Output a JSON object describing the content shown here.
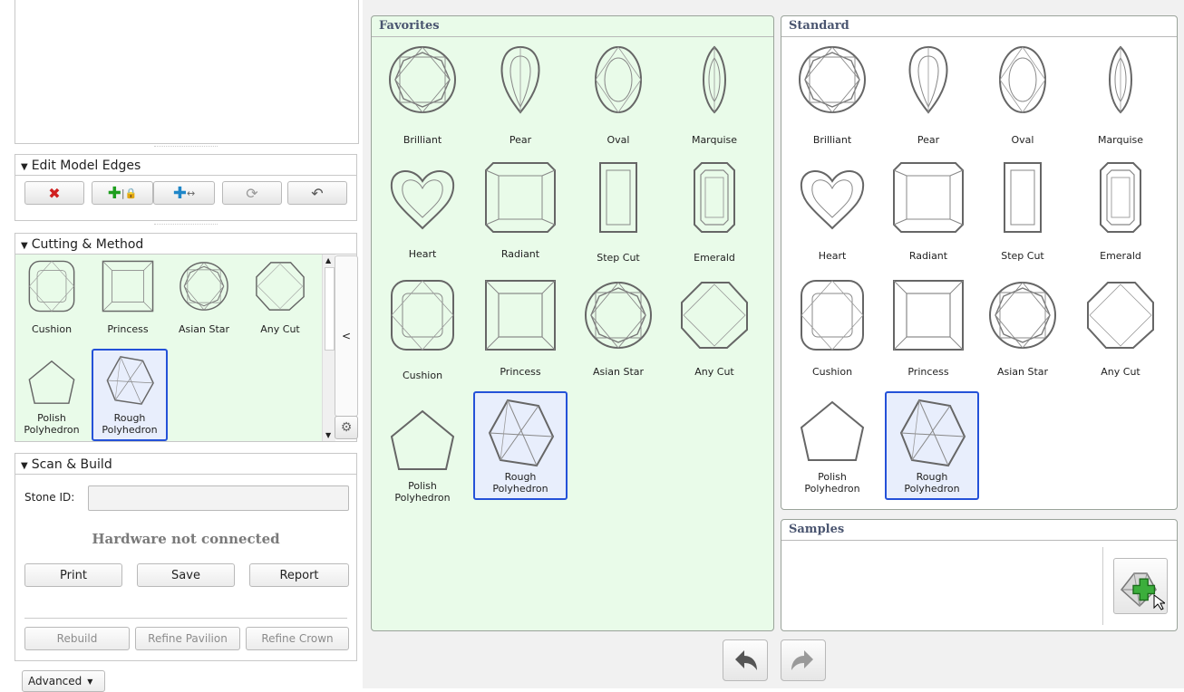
{
  "edit_edges": {
    "title": "Edit Model Edges",
    "buttons": [
      "delete-icon",
      "add-lock-icon",
      "add-move-icon",
      "refresh-icon",
      "undo-icon"
    ]
  },
  "cutting": {
    "title": "Cutting & Method",
    "items": [
      "Cushion",
      "Princess",
      "Asian Star",
      "Any Cut"
    ],
    "polish_line1": "Polish",
    "polish_line2": "Polyhedron",
    "rough_line1": "Rough",
    "rough_line2": "Polyhedron",
    "collapse_label": "<"
  },
  "scan": {
    "title": "Scan & Build",
    "stone_id_label": "Stone ID:",
    "stone_id_value": "",
    "status": "Hardware not connected",
    "print": "Print",
    "save": "Save",
    "report": "Report",
    "rebuild": "Rebuild",
    "refine_pavilion": "Refine Pavilion",
    "refine_crown": "Refine Crown"
  },
  "advanced_label": "Advanced",
  "favorites": {
    "title": "Favorites",
    "items": [
      "Brilliant",
      "Pear",
      "Oval",
      "Marquise",
      "Heart",
      "Radiant",
      "Step Cut",
      "Emerald",
      "Cushion",
      "Princess",
      "Asian Star",
      "Any Cut"
    ],
    "polish_line1": "Polish",
    "polish_line2": "Polyhedron",
    "rough_line1": "Rough",
    "rough_line2": "Polyhedron"
  },
  "standard": {
    "title": "Standard",
    "items": [
      "Brilliant",
      "Pear",
      "Oval",
      "Marquise",
      "Heart",
      "Radiant",
      "Step Cut",
      "Emerald",
      "Cushion",
      "Princess",
      "Asian Star",
      "Any Cut"
    ],
    "polish_line1": "Polish",
    "polish_line2": "Polyhedron",
    "rough_line1": "Rough",
    "rough_line2": "Polyhedron"
  },
  "samples": {
    "title": "Samples"
  },
  "colors": {
    "favorites_bg": "#e9fbe9",
    "selection": "#2451d8",
    "title_text": "#4a5570"
  }
}
